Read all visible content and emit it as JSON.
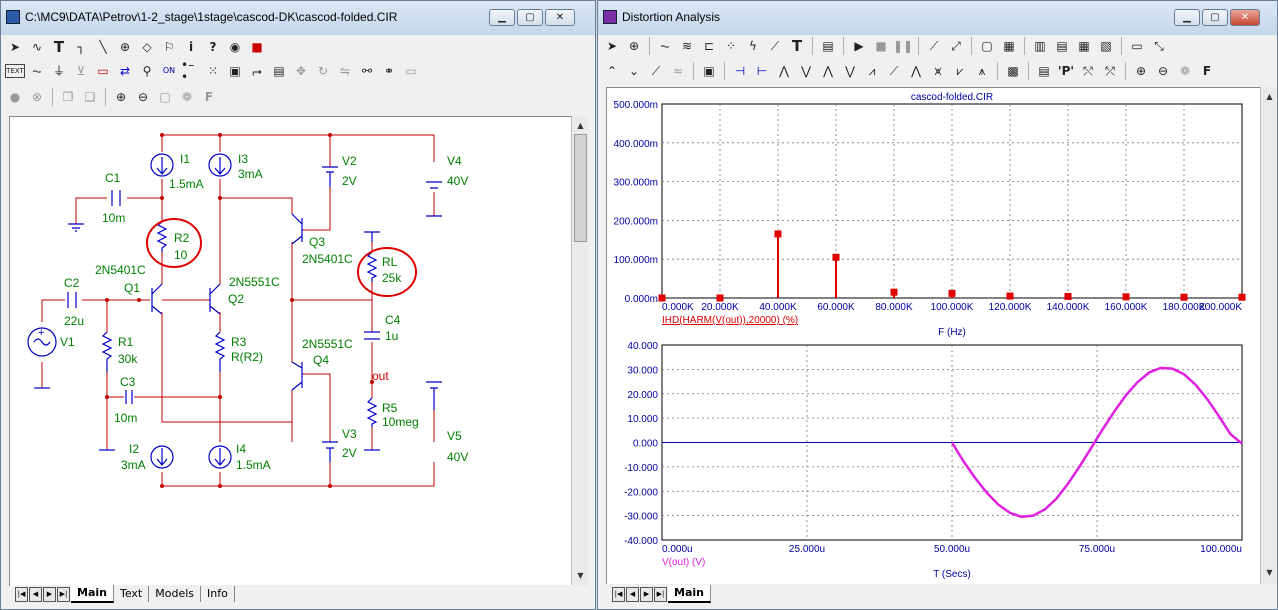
{
  "left_window": {
    "title": "C:\\MC9\\DATA\\Petrov\\1-2_stage\\1stage\\cascod-DK\\cascod-folded.CIR",
    "tabs": [
      "Main",
      "Text",
      "Models",
      "Info"
    ]
  },
  "right_window": {
    "title": "Distortion Analysis",
    "tabs": [
      "Main"
    ]
  },
  "schematic": {
    "C1": {
      "name": "C1",
      "value": "10m"
    },
    "C2": {
      "name": "C2",
      "value": "22u"
    },
    "C3": {
      "name": "C3",
      "value": "10m"
    },
    "C4": {
      "name": "C4",
      "value": "1u"
    },
    "R1": {
      "name": "R1",
      "value": "30k"
    },
    "R2": {
      "name": "R2",
      "value": "10"
    },
    "R3": {
      "name": "R3",
      "value": "R(R2)"
    },
    "R5": {
      "name": "R5",
      "value": "10meg"
    },
    "RL": {
      "name": "RL",
      "value": "25k"
    },
    "I1": {
      "name": "I1",
      "value": "1.5mA"
    },
    "I2": {
      "name": "I2",
      "value": "3mA"
    },
    "I3": {
      "name": "I3",
      "value": "3mA"
    },
    "I4": {
      "name": "I4",
      "value": "1.5mA"
    },
    "V1": {
      "name": "V1"
    },
    "V2": {
      "name": "V2",
      "value": "2V"
    },
    "V3": {
      "name": "V3",
      "value": "2V"
    },
    "V4": {
      "name": "V4",
      "value": "40V"
    },
    "V5": {
      "name": "V5",
      "value": "40V"
    },
    "Q1": {
      "name": "Q1",
      "model": "2N5401C"
    },
    "Q2": {
      "name": "Q2",
      "model": "2N5551C"
    },
    "Q3": {
      "name": "Q3",
      "model": "2N5401C"
    },
    "Q4": {
      "name": "Q4",
      "model": "2N5551C"
    },
    "out_label": "out",
    "colors": {
      "wire": "#c00000",
      "component": "#0000c8",
      "label": "#008000",
      "highlight": "#e00000"
    }
  },
  "chart_data": [
    {
      "type": "bar",
      "title": "cascod-folded.CIR",
      "xlabel": "F (Hz)",
      "trace_label": "IHD(HARM(V(out)),20000) (%)",
      "x": [
        0,
        20000,
        40000,
        60000,
        80000,
        100000,
        120000,
        140000,
        160000,
        180000,
        200000
      ],
      "values": [
        0,
        0,
        0.165,
        0.105,
        0.015,
        0.012,
        0.005,
        0.004,
        0.003,
        0.002,
        0.002
      ],
      "xlim": [
        0,
        200000
      ],
      "ylim": [
        0,
        0.5
      ],
      "xticks": [
        "0.000K",
        "20.000K",
        "40.000K",
        "60.000K",
        "80.000K",
        "100.000K",
        "120.000K",
        "140.000K",
        "160.000K",
        "180.000K",
        "200.000K"
      ],
      "yticks": [
        "0.000m",
        "100.000m",
        "200.000m",
        "300.000m",
        "400.000m",
        "500.000m"
      ],
      "grid": true,
      "color": "#e00000"
    },
    {
      "type": "line",
      "xlabel": "T (Secs)",
      "trace_label": "V(out) (V)",
      "series": [
        {
          "x": [
            50,
            52,
            54,
            56,
            58,
            60,
            62,
            64,
            66,
            68,
            70,
            72,
            74,
            76,
            78,
            80,
            82,
            84,
            86,
            88,
            90,
            92,
            94,
            96,
            98,
            100
          ],
          "y": [
            0,
            -7.8,
            -14.6,
            -20.6,
            -25.5,
            -28.9,
            -30.5,
            -30.0,
            -27.5,
            -23.0,
            -16.9,
            -9.8,
            -2.2,
            5.5,
            12.8,
            19.4,
            24.8,
            28.7,
            30.6,
            30.3,
            28.0,
            23.7,
            17.8,
            10.9,
            3.5,
            -0.5
          ]
        }
      ],
      "xlim": [
        0,
        100
      ],
      "ylim": [
        -40,
        40
      ],
      "xticks": [
        "0.000u",
        "25.000u",
        "50.000u",
        "75.000u",
        "100.000u"
      ],
      "yticks": [
        "-40.000",
        "-30.000",
        "-20.000",
        "-10.000",
        "0.000",
        "10.000",
        "20.000",
        "30.000",
        "40.000"
      ],
      "grid": true,
      "color": "#e020e0"
    }
  ]
}
